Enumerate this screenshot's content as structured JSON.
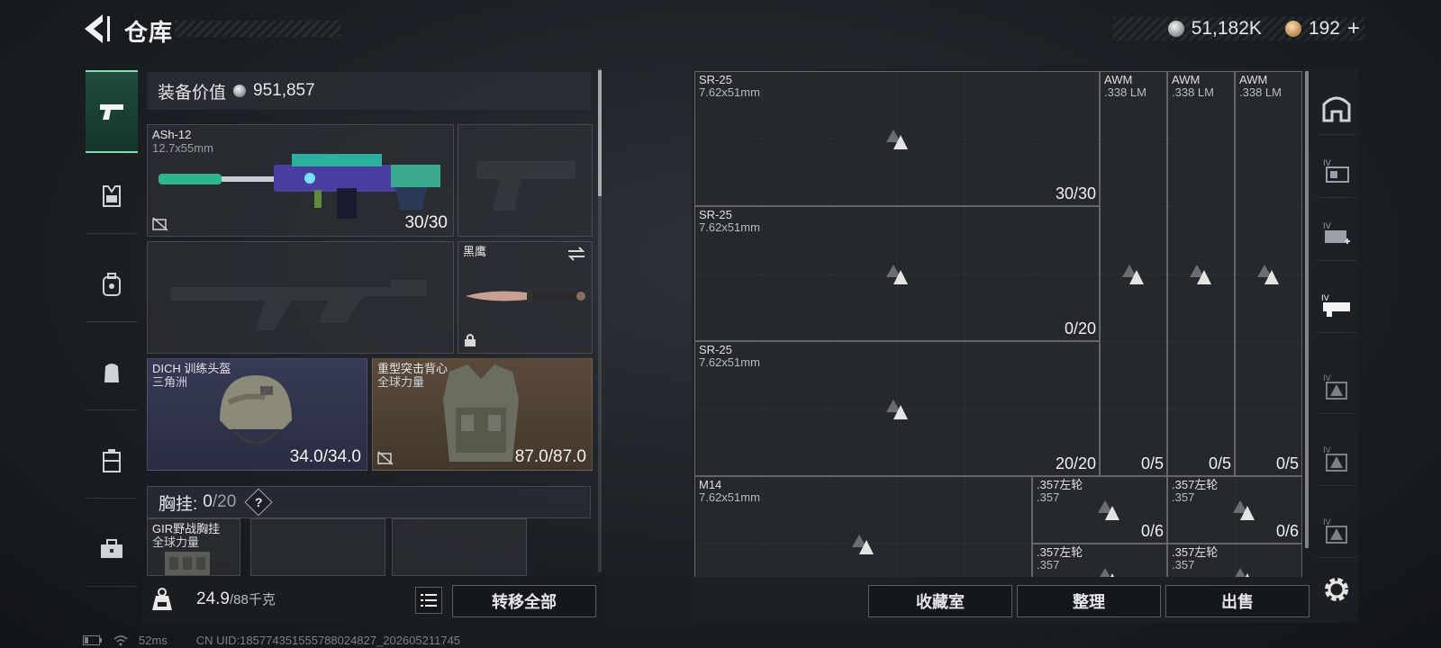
{
  "header": {
    "title": "仓库",
    "silver": "51,182K",
    "gold": "192",
    "plus": "+"
  },
  "categories": [
    "weapons",
    "chest-rig",
    "backpack",
    "pouch",
    "armor-case",
    "toolbox"
  ],
  "loadout": {
    "value_label": "装备价值",
    "value": "951,857",
    "primary": {
      "name": "ASh-12",
      "caliber": "12.7x55mm",
      "ammo": "30/30"
    },
    "melee": {
      "name": "黑鹰"
    },
    "helmet": {
      "name": "DICH 训练头盔",
      "faction": "三角洲",
      "durability": "34.0/34.0"
    },
    "vest": {
      "name": "重型突击背心",
      "faction": "全球力量",
      "durability": "87.0/87.0"
    },
    "rig_label": "胸挂:",
    "rig_current": "0",
    "rig_max": "/20",
    "rig_help": "?",
    "rig_item": {
      "name": "GIR野战胸挂",
      "faction": "全球力量"
    },
    "weight": "24.9",
    "weight_max": "/88千克",
    "transfer_all": "转移全部"
  },
  "storage": {
    "items": [
      {
        "name": "SR-25",
        "caliber": "7.62x51mm",
        "count": "30/30"
      },
      {
        "name": "SR-25",
        "caliber": "7.62x51mm",
        "count": "0/20"
      },
      {
        "name": "SR-25",
        "caliber": "7.62x51mm",
        "count": "20/20"
      },
      {
        "name": "AWM",
        "caliber": ".338 LM",
        "count": "0/5"
      },
      {
        "name": "AWM",
        "caliber": ".338 LM",
        "count": "0/5"
      },
      {
        "name": "AWM",
        "caliber": ".338 LM",
        "count": "0/5"
      },
      {
        "name": "M14",
        "caliber": "7.62x51mm",
        "count": ""
      },
      {
        "name": ".357左轮",
        "caliber": ".357",
        "count": "0/6"
      },
      {
        "name": ".357左轮",
        "caliber": ".357",
        "count": "0/6"
      },
      {
        "name": ".357左轮",
        "caliber": ".357",
        "count": ""
      },
      {
        "name": ".357左轮",
        "caliber": ".357",
        "count": ""
      }
    ],
    "buttons": {
      "collection": "收藏室",
      "sort": "整理",
      "sell": "出售"
    }
  },
  "status": {
    "ping": "52ms",
    "uid": "CN UID:1857743515557880248​27_202605211745"
  },
  "colors": {
    "accent_green": "#7fe0b5",
    "helmet_bg": "#2e3148",
    "vest_bg": "#4c3f31"
  }
}
